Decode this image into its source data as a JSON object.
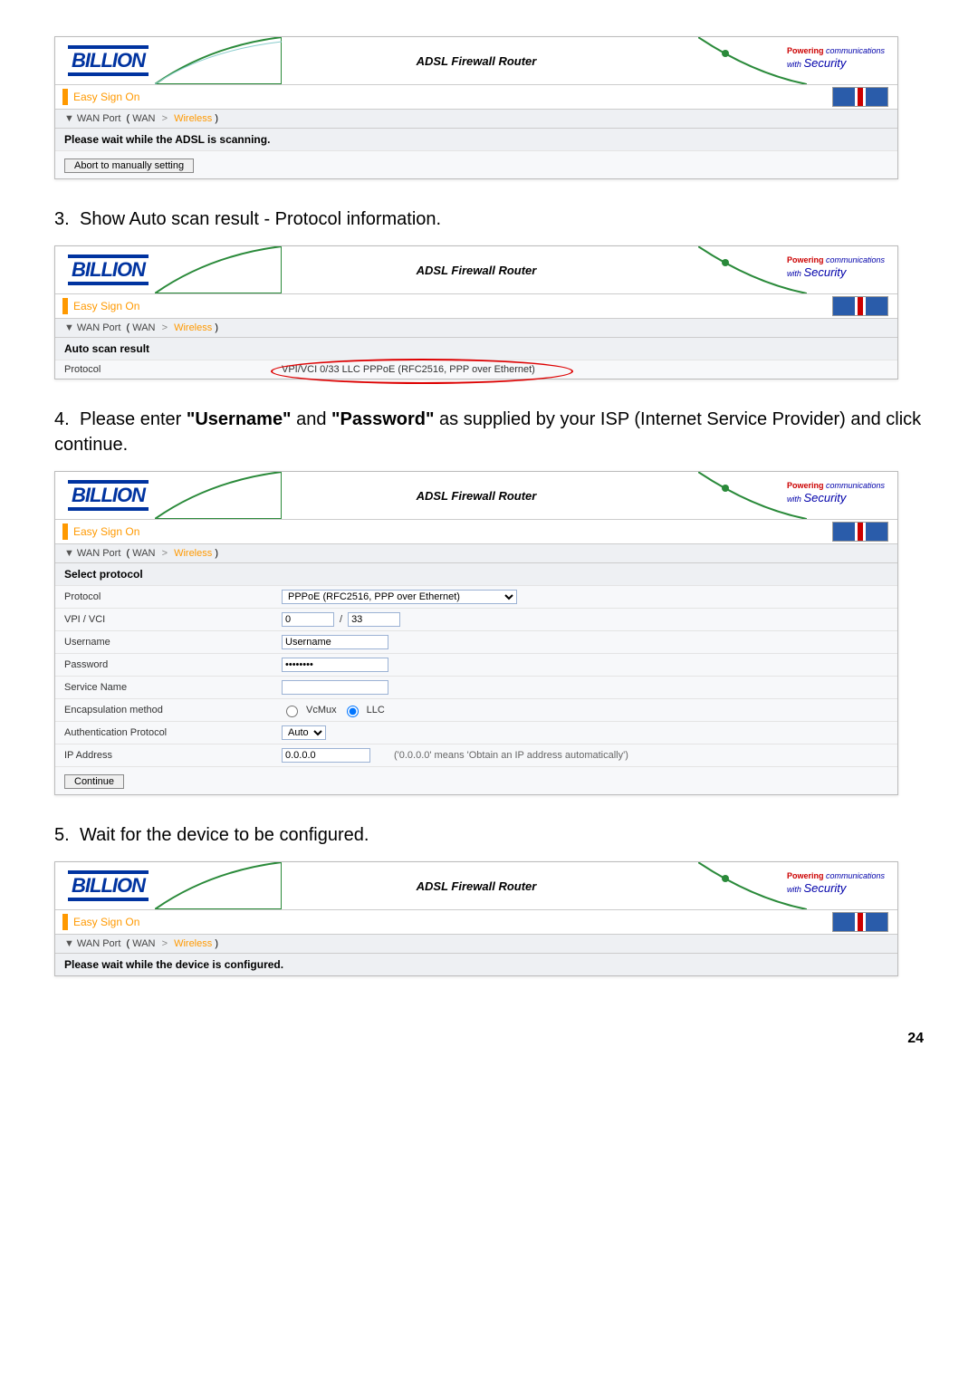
{
  "brand": "BILLION",
  "router_title": "ADSL Firewall Router",
  "tagline": {
    "p1": "Powering",
    "p2": "communications",
    "p3": "with Security"
  },
  "subheader": "Easy Sign On",
  "crumb": {
    "tri": "▼",
    "wan_port": "WAN Port",
    "open": "(",
    "wan": "WAN",
    "gt": ">",
    "wireless": "Wireless",
    "close": ")"
  },
  "card1": {
    "banner": "Please wait while the ADSL is scanning.",
    "abort_btn": "Abort to manually setting"
  },
  "step3": "Show Auto scan result - Protocol information.",
  "card2": {
    "banner": "Auto scan result",
    "protocol_label": "Protocol",
    "protocol_value": "VPI/VCI 0/33 LLC PPPoE (RFC2516, PPP over Ethernet)"
  },
  "step4_a": "Please enter ",
  "step4_b": "\"Username\"",
  "step4_c": " and ",
  "step4_d": "\"Password\"",
  "step4_e": " as supplied by your ISP (Internet Service Provider) and click continue.",
  "card3": {
    "banner": "Select protocol",
    "rows": {
      "protocol": "Protocol",
      "protocol_sel": "PPPoE (RFC2516, PPP over Ethernet)",
      "vpivci": "VPI / VCI",
      "vpi_val": "0",
      "vci_val": "33",
      "slash": "/",
      "username": "Username",
      "username_ph": "Username",
      "password": "Password",
      "password_val": "••••••••",
      "service": "Service Name",
      "encap": "Encapsulation method",
      "vcmux": "VcMux",
      "llc": "LLC",
      "auth": "Authentication Protocol",
      "auth_sel": "Auto",
      "ip": "IP Address",
      "ip_val": "0.0.0.0",
      "ip_hint": "('0.0.0.0' means 'Obtain an IP address automatically')"
    },
    "continue_btn": "Continue"
  },
  "step5": "Wait for the device to be configured.",
  "card4": {
    "banner": "Please wait while the device is configured."
  },
  "page_num": "24"
}
